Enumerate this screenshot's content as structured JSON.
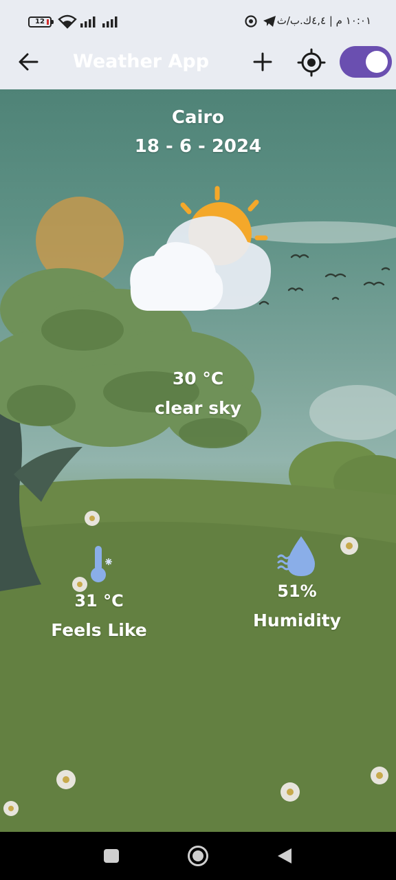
{
  "status_bar": {
    "battery_level": "12",
    "time_text": "١٠:٠١ م | ٤,٤ك.ب/ث",
    "icons": [
      "battery-icon",
      "wifi-icon",
      "signal-icon",
      "signal-icon",
      "whatsapp-icon",
      "telegram-icon"
    ]
  },
  "app_bar": {
    "title": "Weather App",
    "back_icon": "arrow-left-icon",
    "add_icon": "plus-icon",
    "location_icon": "gps-target-icon",
    "toggle_on": true,
    "toggle_color": "#6a4fb0"
  },
  "weather": {
    "city": "Cairo",
    "date": "18 - 6 - 2024",
    "condition_icon": "partly-cloudy-icon",
    "temperature": "30 °C",
    "description": "clear sky"
  },
  "details": {
    "feels_like": {
      "icon": "thermometer-icon",
      "value": "31 °C",
      "label": "Feels Like"
    },
    "humidity": {
      "icon": "water-drop-icon",
      "value": "51%",
      "label": "Humidity"
    }
  },
  "nav_bar": {
    "icons": [
      "recents-square-icon",
      "home-circle-icon",
      "back-triangle-icon"
    ]
  }
}
